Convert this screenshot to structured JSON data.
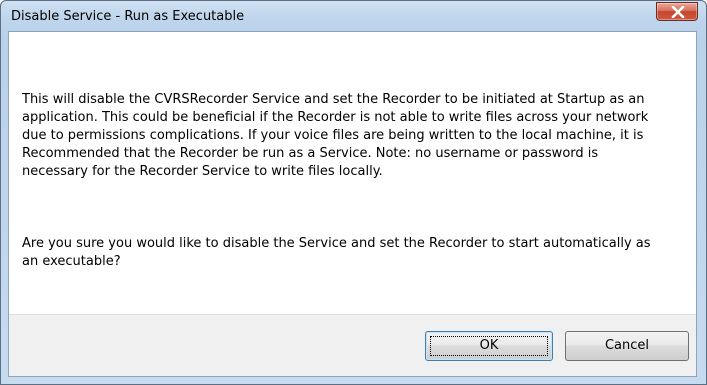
{
  "window": {
    "title": "Disable Service - Run as Executable",
    "close_icon": "close-x-icon"
  },
  "dialog": {
    "message": "This will disable the CVRSRecorder Service and set the Recorder to be initiated at Startup as an application.  This could be beneficial if the Recorder is not able to write files across your network due to permissions complications.  If your voice files are being written to the local machine, it is Recommended that the Recorder be run as a Service.  Note: no username or password is necessary for the Recorder Service to write files locally.",
    "question": "Are you sure you would like to disable the Service and set the Recorder to start automatically as an executable?"
  },
  "buttons": {
    "ok_label": "OK",
    "cancel_label": "Cancel"
  },
  "colors": {
    "title_bar": "#bed5ec",
    "close_button": "#c4452d",
    "footer": "#f0f0f0",
    "default_button_border": "#3c7fb1"
  }
}
